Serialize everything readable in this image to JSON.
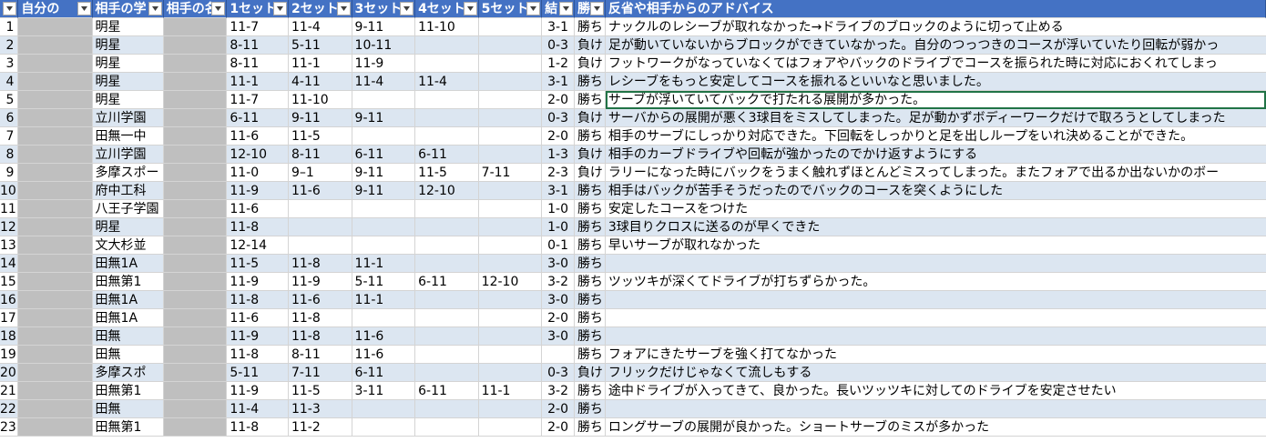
{
  "header": {
    "row_label": "",
    "columns": [
      "自分の",
      "相手の学",
      "相手の名",
      "1セット",
      "2セット",
      "3セット",
      "4セット",
      "5セット",
      "結",
      "勝",
      "反省や相手からのアドバイス"
    ]
  },
  "rows": [
    {
      "n": "1",
      "school": "明星",
      "s1": "11-7",
      "s2": "11-4",
      "s3": "9-11",
      "s4": "11-10",
      "s5": "",
      "score": "3-1",
      "res": "勝ち",
      "note": "ナックルのレシーブが取れなかった→ドライブのブロックのように切って止める"
    },
    {
      "n": "2",
      "school": "明星",
      "s1": "8-11",
      "s2": "5-11",
      "s3": "10-11",
      "s4": "",
      "s5": "",
      "score": "0-3",
      "res": "負け",
      "note": "足が動いていないからブロックができていなかった。自分のつっつきのコースが浮いていたり回転が弱かっ"
    },
    {
      "n": "3",
      "school": "明星",
      "s1": "8-11",
      "s2": "11-1",
      "s3": "11-9",
      "s4": "",
      "s5": "",
      "score": "1-2",
      "res": "負け",
      "note": "フットワークがなっていなくてはフォアやバックのドライブでコースを振られた時に対応におくれてしまっ"
    },
    {
      "n": "4",
      "school": "明星",
      "s1": "11-1",
      "s2": "4-11",
      "s3": "11-4",
      "s4": "11-4",
      "s5": "",
      "score": "3-1",
      "res": "勝ち",
      "note": "レシーブをもっと安定してコースを振れるといいなと思いました。"
    },
    {
      "n": "5",
      "school": "明星",
      "s1": "11-7",
      "s2": "11-10",
      "s3": "",
      "s4": "",
      "s5": "",
      "score": "2-0",
      "res": "勝ち",
      "note": "サーブが浮いていてバックで打たれる展開が多かった。"
    },
    {
      "n": "6",
      "school": "立川学園",
      "s1": "6-11",
      "s2": "9-11",
      "s3": "9-11",
      "s4": "",
      "s5": "",
      "score": "0-3",
      "res": "負け",
      "note": "サーバからの展開が悪く3球目をミスしてしまった。足が動かずボディーワークだけで取ろうとしてしまった"
    },
    {
      "n": "7",
      "school": "田無一中",
      "s1": "11-6",
      "s2": "11-5",
      "s3": "",
      "s4": "",
      "s5": "",
      "score": "2-0",
      "res": "勝ち",
      "note": "相手のサーブにしっかり対応できた。下回転をしっかりと足を出しループをいれ決めることができた。"
    },
    {
      "n": "8",
      "school": "立川学園",
      "s1": "12-10",
      "s2": "8-11",
      "s3": "6-11",
      "s4": "6-11",
      "s5": "",
      "score": "1-3",
      "res": "負け",
      "note": "相手のカーブドライブや回転が強かったのでかけ返すようにする"
    },
    {
      "n": "9",
      "school": "多摩スポー",
      "s1": "11-0",
      "s2": "9–1",
      "s3": "9-11",
      "s4": "11-5",
      "s5": "7-11",
      "score": "2-3",
      "res": "負け",
      "note": "ラリーになった時にバックをうまく触れずほとんどミスってしまった。またフォアで出るか出ないかのボー"
    },
    {
      "n": "10",
      "school": "府中工科",
      "s1": "11-9",
      "s2": "11-6",
      "s3": "9-11",
      "s4": "12-10",
      "s5": "",
      "score": "3-1",
      "res": "勝ち",
      "note": "相手はバックが苦手そうだったのでバックのコースを突くようにした"
    },
    {
      "n": "11",
      "school": "八王子学園",
      "s1": "11-6",
      "s2": "",
      "s3": "",
      "s4": "",
      "s5": "",
      "score": "1-0",
      "res": "勝ち",
      "note": "安定したコースをつけた"
    },
    {
      "n": "12",
      "school": "明星",
      "s1": "11-8",
      "s2": "",
      "s3": "",
      "s4": "",
      "s5": "",
      "score": "1-0",
      "res": "勝ち",
      "note": "3球目りクロスに送るのが早くできた"
    },
    {
      "n": "13",
      "school": "文大杉並",
      "s1": "12-14",
      "s2": "",
      "s3": "",
      "s4": "",
      "s5": "",
      "score": "0-1",
      "res": "勝ち",
      "note": "早いサーブが取れなかった"
    },
    {
      "n": "14",
      "school": "田無1A",
      "s1": "11-5",
      "s2": "11-8",
      "s3": "11-1",
      "s4": "",
      "s5": "",
      "score": "3-0",
      "res": "勝ち",
      "note": ""
    },
    {
      "n": "15",
      "school": "田無第1",
      "s1": "11-9",
      "s2": "11-9",
      "s3": "5-11",
      "s4": "6-11",
      "s5": "12-10",
      "score": "3-2",
      "res": "勝ち",
      "note": "ツッツキが深くてドライブが打ちずらかった。"
    },
    {
      "n": "16",
      "school": "田無1A",
      "s1": "11-8",
      "s2": "11-6",
      "s3": "11-1",
      "s4": "",
      "s5": "",
      "score": "3-0",
      "res": "勝ち",
      "note": ""
    },
    {
      "n": "17",
      "school": "田無1A",
      "s1": "11-6",
      "s2": "11-8",
      "s3": "",
      "s4": "",
      "s5": "",
      "score": "2-0",
      "res": "勝ち",
      "note": ""
    },
    {
      "n": "18",
      "school": "田無",
      "s1": "11-9",
      "s2": "11-8",
      "s3": "11-6",
      "s4": "",
      "s5": "",
      "score": "3-0",
      "res": "勝ち",
      "note": ""
    },
    {
      "n": "19",
      "school": "田無",
      "s1": "11-8",
      "s2": "8-11",
      "s3": "11-6",
      "s4": "",
      "s5": "",
      "score": "",
      "res": "勝ち",
      "note": "フォアにきたサーブを強く打てなかった"
    },
    {
      "n": "20",
      "school": "多摩スポ",
      "s1": "5-11",
      "s2": "7-11",
      "s3": "6-11",
      "s4": "",
      "s5": "",
      "score": "0-3",
      "res": "負け",
      "note": "フリックだけじゃなくて流しもする"
    },
    {
      "n": "21",
      "school": "田無第1",
      "s1": "11-9",
      "s2": "11-5",
      "s3": "3-11",
      "s4": "6-11",
      "s5": "11-1",
      "score": "3-2",
      "res": "勝ち",
      "note": "途中ドライブが入ってきて、良かった。長いツッツキに対してのドライブを安定させたい"
    },
    {
      "n": "22",
      "school": "田無",
      "s1": "11-4",
      "s2": "11-3",
      "s3": "",
      "s4": "",
      "s5": "",
      "score": "2-0",
      "res": "勝ち",
      "note": ""
    },
    {
      "n": "23",
      "school": "田無第1",
      "s1": "11-8",
      "s2": "11-2",
      "s3": "",
      "s4": "",
      "s5": "",
      "score": "2-0",
      "res": "勝ち",
      "note": "ロングサーブの展開が良かった。ショートサーブのミスが多かった"
    }
  ],
  "selected_row": "5",
  "colors": {
    "header": "#4472c4",
    "band": "#dce6f1",
    "redacted": "#bfbfbf",
    "selection": "#217346"
  }
}
